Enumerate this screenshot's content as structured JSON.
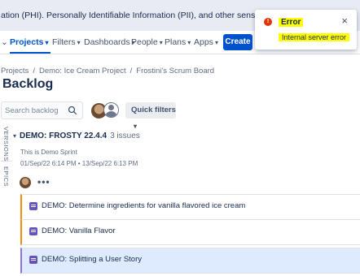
{
  "banner": {
    "text": "ation (PHI). Personally Identifiable Information (PII), and other sensitive data cannot be placed"
  },
  "nav": {
    "first_item_chevron": "⌄",
    "items": [
      {
        "label": "Projects"
      },
      {
        "label": "Filters"
      },
      {
        "label": "Dashboards"
      },
      {
        "label": "People"
      },
      {
        "label": "Plans"
      },
      {
        "label": "Apps"
      }
    ],
    "create_label": "Create"
  },
  "breadcrumb": {
    "items": [
      "Projects",
      "Demo: Ice Cream Project",
      "Frostini's Scrum Board"
    ],
    "separator": "/"
  },
  "page": {
    "title": "Backlog"
  },
  "search": {
    "placeholder": "Search backlog"
  },
  "quick_filters": {
    "label": "Quick filters"
  },
  "side_tabs": {
    "versions": "VERSIONS",
    "epics": "EPICS"
  },
  "sprint": {
    "name": "DEMO: FROSTY 22.4.4",
    "count": "3 issues",
    "goal": "This is Demo Sprint",
    "dates": "01/Sep/22 6:14 PM • 13/Sep/22 6:13 PM",
    "more": "•••"
  },
  "issues": [
    {
      "summary": "DEMO: Determine ingredients for vanilla flavored ice cream"
    },
    {
      "summary": "DEMO: Vanilla Flavor"
    },
    {
      "summary": "DEMO: Splitting a User Story"
    }
  ],
  "error": {
    "title": "Error",
    "message": "Internal server error",
    "close": "×",
    "icon_glyph": "!"
  },
  "colors": {
    "accent": "#0052cc",
    "highlight": "#ffff00",
    "error": "#de350b",
    "story_icon": "#6554c0",
    "selected_row": "#deebff"
  },
  "icons": [
    "search-icon",
    "chevron-down-icon",
    "error-icon",
    "close-icon",
    "story-icon",
    "user-avatar-icon"
  ]
}
